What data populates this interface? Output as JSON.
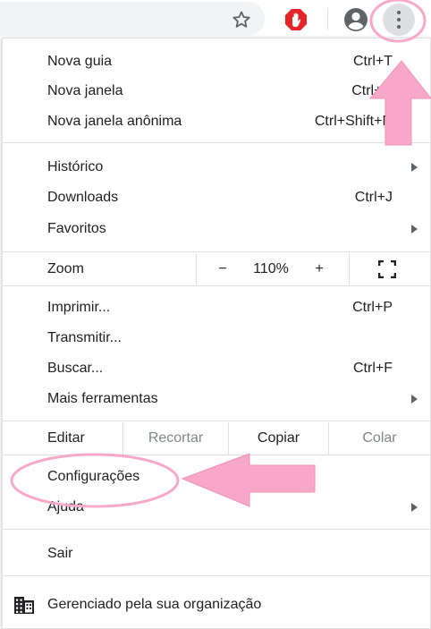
{
  "toolbar": {
    "icons": [
      "star-icon",
      "adblock-hand-icon",
      "profile-icon",
      "more-vert-icon"
    ]
  },
  "menu": {
    "group1": [
      {
        "label": "Nova guia",
        "shortcut": "Ctrl+T"
      },
      {
        "label": "Nova janela",
        "shortcut": "Ctrl+N"
      },
      {
        "label": "Nova janela anônima",
        "shortcut": "Ctrl+Shift+N"
      }
    ],
    "group2": [
      {
        "label": "Histórico"
      },
      {
        "label": "Downloads",
        "shortcut": "Ctrl+J"
      },
      {
        "label": "Favoritos"
      }
    ],
    "zoom": {
      "label": "Zoom",
      "minus": "−",
      "value": "110%",
      "plus": "+"
    },
    "group3": [
      {
        "label": "Imprimir...",
        "shortcut": "Ctrl+P"
      },
      {
        "label": "Transmitir..."
      },
      {
        "label": "Buscar...",
        "shortcut": "Ctrl+F"
      },
      {
        "label": "Mais ferramentas"
      }
    ],
    "edit": {
      "label": "Editar",
      "cut": "Recortar",
      "copy": "Copiar",
      "paste": "Colar"
    },
    "group4": [
      {
        "label": "Configurações"
      },
      {
        "label": "Ajuda"
      }
    ],
    "exit": {
      "label": "Sair"
    },
    "managed": {
      "label": "Gerenciado pela sua organização"
    }
  },
  "colors": {
    "annotation_pink": "#f7a8c8",
    "text": "#202124",
    "disabled": "#80868b"
  }
}
